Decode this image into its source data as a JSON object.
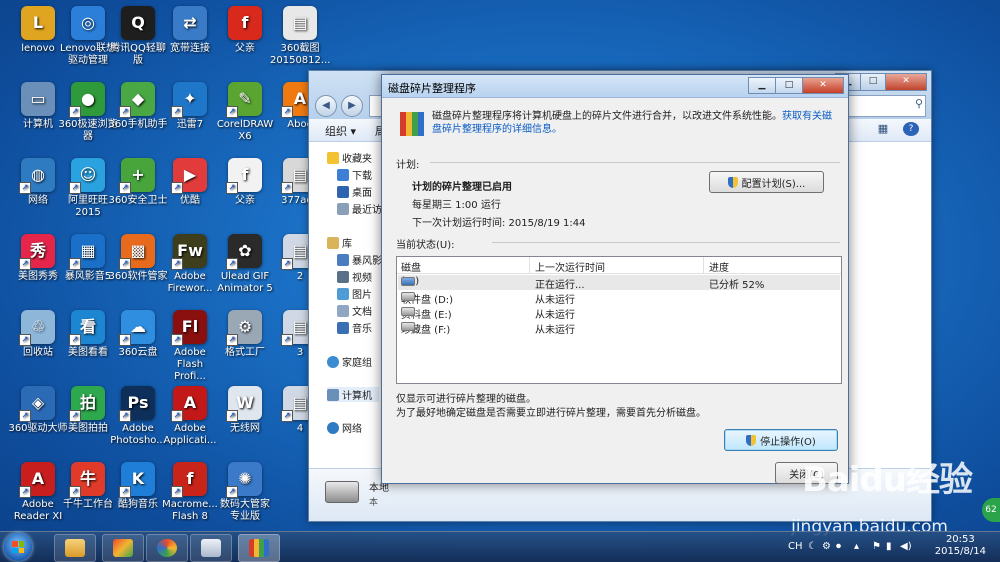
{
  "desktop": {
    "icons": [
      {
        "label": "lenovo",
        "color": "#e0a520",
        "glyph": "L"
      },
      {
        "label": "Lenovo联想驱动管理",
        "color": "#2b7fd9",
        "glyph": "◎"
      },
      {
        "label": "腾讯QQ轻聊版",
        "color": "#1e1e1e",
        "glyph": "Q"
      },
      {
        "label": "宽带连接",
        "color": "#3a7bc8",
        "glyph": "⇄"
      },
      {
        "label": "父亲",
        "color": "#d9291c",
        "glyph": "f"
      },
      {
        "label": "360截图20150812...",
        "color": "#e8e8e8",
        "glyph": "▤"
      },
      {
        "label": "计算机",
        "color": "#6a8fb8",
        "glyph": "▭"
      },
      {
        "label": "360极速浏览器",
        "color": "#2f9a3a",
        "glyph": "●"
      },
      {
        "label": "360手机助手",
        "color": "#49a844",
        "glyph": "◆"
      },
      {
        "label": "迅雷7",
        "color": "#1f77c9",
        "glyph": "✦"
      },
      {
        "label": "CorelDRAW X6",
        "color": "#5aa532",
        "glyph": "✎"
      },
      {
        "label": "Aboo",
        "color": "#f07a10",
        "glyph": "A"
      },
      {
        "label": "网络",
        "color": "#2f7bc2",
        "glyph": "◍"
      },
      {
        "label": "阿里旺旺2015",
        "color": "#2aa2e0",
        "glyph": "☺"
      },
      {
        "label": "360安全卫士",
        "color": "#47a53c",
        "glyph": "+"
      },
      {
        "label": "优酷",
        "color": "#e23b3b",
        "glyph": "▶"
      },
      {
        "label": "父亲",
        "color": "#f2f2f2",
        "glyph": "f"
      },
      {
        "label": "377ada",
        "color": "#d8d8d8",
        "glyph": "▤"
      },
      {
        "label": "美图秀秀",
        "color": "#e5264a",
        "glyph": "秀"
      },
      {
        "label": "暴风影音5",
        "color": "#1a6fc8",
        "glyph": "▦"
      },
      {
        "label": "360软件管家",
        "color": "#e86a1c",
        "glyph": "▩"
      },
      {
        "label": "Adobe Firewor...",
        "color": "#3e3e1c",
        "glyph": "Fw"
      },
      {
        "label": "Ulead GIF Animator 5",
        "color": "#2a2a2a",
        "glyph": "✿"
      },
      {
        "label": "2",
        "color": "#cfd8e4",
        "glyph": "▤"
      },
      {
        "label": "回收站",
        "color": "#8db6d9",
        "glyph": "♲"
      },
      {
        "label": "美图看看",
        "color": "#1d86d2",
        "glyph": "看"
      },
      {
        "label": "360云盘",
        "color": "#2f8ee0",
        "glyph": "☁"
      },
      {
        "label": "Adobe Flash Profi...",
        "color": "#8a0f0f",
        "glyph": "Fl"
      },
      {
        "label": "格式工厂",
        "color": "#9aa8b6",
        "glyph": "⚙"
      },
      {
        "label": "3",
        "color": "#cfd8e4",
        "glyph": "▤"
      },
      {
        "label": "360驱动大师",
        "color": "#2b6bb6",
        "glyph": "◈"
      },
      {
        "label": "美图拍拍",
        "color": "#2ea84c",
        "glyph": "拍"
      },
      {
        "label": "Adobe Photosho...",
        "color": "#0d2f5a",
        "glyph": "Ps"
      },
      {
        "label": "Adobe Applicati...",
        "color": "#c21818",
        "glyph": "A"
      },
      {
        "label": "无线网",
        "color": "#dfe6ee",
        "glyph": "W"
      },
      {
        "label": "4",
        "color": "#cfd8e4",
        "glyph": "▤"
      },
      {
        "label": "Adobe Reader XI",
        "color": "#c81e1e",
        "glyph": "A"
      },
      {
        "label": "千牛工作台",
        "color": "#e03b2a",
        "glyph": "牛"
      },
      {
        "label": "酷狗音乐",
        "color": "#1f7fd8",
        "glyph": "K"
      },
      {
        "label": "Macrome... Flash 8",
        "color": "#c9241a",
        "glyph": "f"
      },
      {
        "label": "数码大管家 专业版",
        "color": "#3b79c9",
        "glyph": "✺"
      }
    ]
  },
  "explorer": {
    "toolbar_organize": "组织 ▾",
    "toolbar_partial": "局",
    "nav": {
      "favorites": "收藏夹",
      "downloads": "下载",
      "desktop": "桌面",
      "recent": "最近访问",
      "libraries": "库",
      "storm": "暴风影视",
      "videos": "视频",
      "pictures": "图片",
      "documents": "文档",
      "music": "音乐",
      "homegroup": "家庭组",
      "computer": "计算机",
      "network": "网络"
    },
    "detail_text": "本地",
    "detail_sub": "本"
  },
  "dialog": {
    "title": "磁盘碎片整理程序",
    "intro": "磁盘碎片整理程序将计算机硬盘上的碎片文件进行合并，以改进文件系统性能。",
    "intro_link": "获取有关磁盘碎片整理程序的详细信息。",
    "schedule_label": "计划:",
    "schedule_enabled": "计划的碎片整理已启用",
    "schedule_when": "每星期三 1:00 运行",
    "schedule_next": "下一次计划运行时间: 2015/8/19 1:44",
    "configure_button": "配置计划(S)...",
    "status_label": "当前状态(U):",
    "columns": [
      "磁盘",
      "上一次运行时间",
      "进度"
    ],
    "rows": [
      {
        "disk": "(C:)",
        "last_run": "正在运行...",
        "progress": "已分析 52%",
        "selected": true
      },
      {
        "disk": "软件盘 (D:)",
        "last_run": "从未运行",
        "progress": ""
      },
      {
        "disk": "资料盘 (E:)",
        "last_run": "从未运行",
        "progress": ""
      },
      {
        "disk": "珍藏盘 (F:)",
        "last_run": "从未运行",
        "progress": ""
      }
    ],
    "note1": "仅显示可进行碎片整理的磁盘。",
    "note2": "为了最好地确定磁盘是否需要立即进行碎片整理，需要首先分析磁盘。",
    "stop_button": "停止操作(O)",
    "close_button": "关闭(C)"
  },
  "taskbar": {
    "lang": "CH",
    "time": "20:53",
    "date": "2015/8/14"
  },
  "watermark": {
    "brand": "Baidu经验",
    "url": "jingyan.baidu.com",
    "badge": "62"
  }
}
